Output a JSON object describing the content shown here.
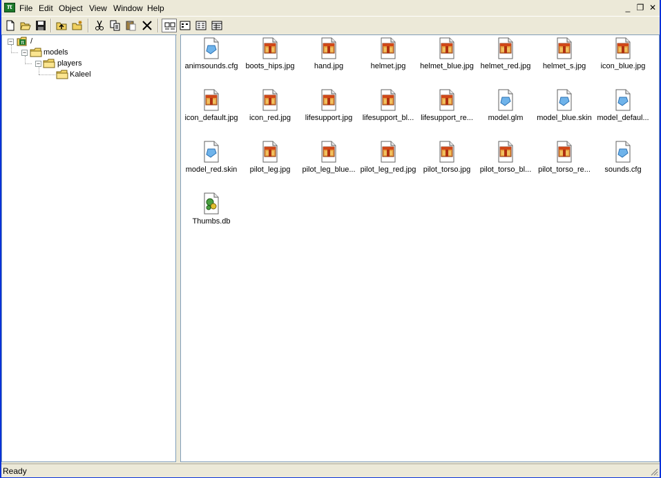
{
  "menubar": {
    "app_icon_glyph": "π",
    "menus": [
      "File",
      "Edit",
      "Object",
      "View",
      "Window",
      "Help"
    ],
    "window_buttons": {
      "minimize": "_",
      "restore": "❐",
      "close": "✕"
    }
  },
  "toolbar": {
    "buttons": [
      "new-icon",
      "open-icon",
      "save-icon",
      "up-folder-icon",
      "new-folder-icon",
      "cut-icon",
      "copy-icon",
      "paste-icon",
      "delete-icon",
      "large-icons-view-icon",
      "small-icons-view-icon",
      "list-view-icon",
      "details-view-icon"
    ],
    "active": "large-icons-view-icon"
  },
  "tree": {
    "root": {
      "label": "/",
      "icon": "app-root-icon",
      "expander": "−"
    },
    "nodes": [
      {
        "label": "models",
        "icon": "folder-icon",
        "expander": "−"
      },
      {
        "label": "players",
        "icon": "folder-icon",
        "expander": "−"
      },
      {
        "label": "Kaleel",
        "icon": "folder-icon",
        "expander": ""
      }
    ]
  },
  "files": [
    {
      "name": "animsounds.cfg",
      "type": "doc"
    },
    {
      "name": "boots_hips.jpg",
      "type": "jpg"
    },
    {
      "name": "hand.jpg",
      "type": "jpg"
    },
    {
      "name": "helmet.jpg",
      "type": "jpg"
    },
    {
      "name": "helmet_blue.jpg",
      "type": "jpg"
    },
    {
      "name": "helmet_red.jpg",
      "type": "jpg"
    },
    {
      "name": "helmet_s.jpg",
      "type": "jpg"
    },
    {
      "name": "icon_blue.jpg",
      "type": "jpg"
    },
    {
      "name": "icon_default.jpg",
      "type": "jpg"
    },
    {
      "name": "icon_red.jpg",
      "type": "jpg"
    },
    {
      "name": "lifesupport.jpg",
      "type": "jpg"
    },
    {
      "name": "lifesupport_bl...",
      "type": "jpg"
    },
    {
      "name": "lifesupport_re...",
      "type": "jpg"
    },
    {
      "name": "model.glm",
      "type": "doc"
    },
    {
      "name": "model_blue.skin",
      "type": "doc"
    },
    {
      "name": "model_defaul...",
      "type": "doc"
    },
    {
      "name": "model_red.skin",
      "type": "doc"
    },
    {
      "name": "pilot_leg.jpg",
      "type": "jpg"
    },
    {
      "name": "pilot_leg_blue...",
      "type": "jpg"
    },
    {
      "name": "pilot_leg_red.jpg",
      "type": "jpg"
    },
    {
      "name": "pilot_torso.jpg",
      "type": "jpg"
    },
    {
      "name": "pilot_torso_bl...",
      "type": "jpg"
    },
    {
      "name": "pilot_torso_re...",
      "type": "jpg"
    },
    {
      "name": "sounds.cfg",
      "type": "doc"
    },
    {
      "name": "Thumbs.db",
      "type": "db"
    }
  ],
  "status": {
    "text": "Ready"
  },
  "colors": {
    "window_border": "#0831d9",
    "face": "#ece9d8",
    "pane_border": "#7f9db9"
  }
}
